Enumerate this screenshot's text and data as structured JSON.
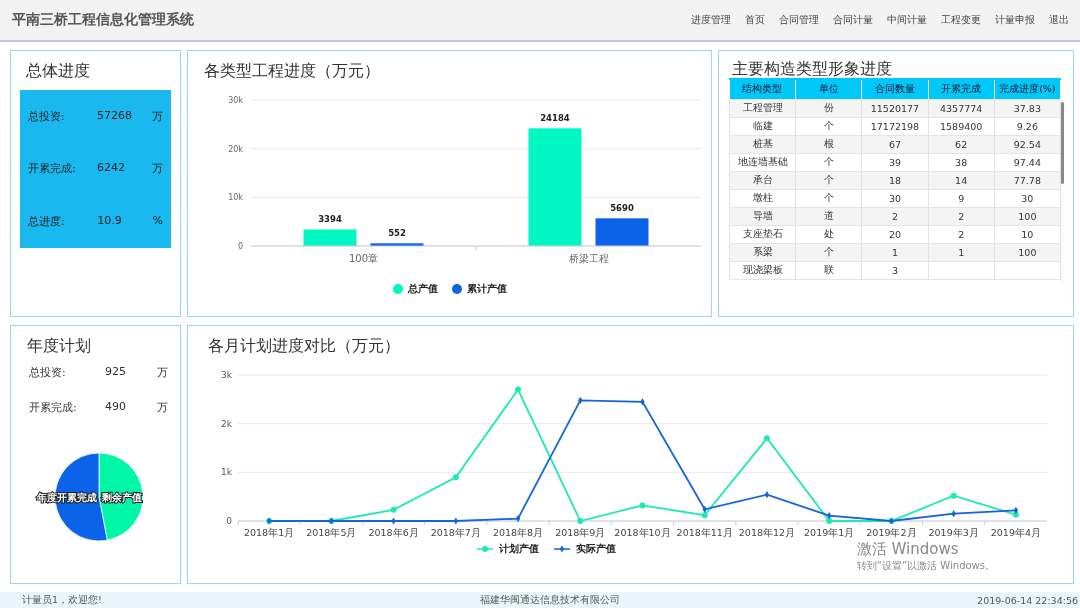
{
  "header": {
    "title": "平南三桥工程信息化管理系统",
    "nav": [
      {
        "label": "进度管理"
      },
      {
        "label": "首页"
      },
      {
        "label": "合同管理"
      },
      {
        "label": "合同计量"
      },
      {
        "label": "中间计量"
      },
      {
        "label": "工程变更"
      },
      {
        "label": "计量申报"
      },
      {
        "label": "退出"
      }
    ]
  },
  "overall": {
    "title": "总体进度",
    "rows": [
      {
        "label": "总投资:",
        "value": "57268",
        "unit": "万"
      },
      {
        "label": "开累完成:",
        "value": "6242",
        "unit": "万"
      },
      {
        "label": "总进度:",
        "value": "10.9",
        "unit": "%"
      }
    ]
  },
  "type_progress": {
    "title": "各类型工程进度（万元）",
    "chart_data": {
      "type": "bar",
      "categories": [
        "100章",
        "桥梁工程"
      ],
      "series": [
        {
          "name": "总产值",
          "color": "#00f7c3",
          "values": [
            3394,
            24184
          ]
        },
        {
          "name": "累计产值",
          "color": "#0a63e8",
          "values": [
            552,
            5690
          ]
        }
      ],
      "ylim": [
        0,
        30000
      ],
      "yticks": [
        {
          "value": 0,
          "label": "0"
        },
        {
          "value": 10000,
          "label": "10k"
        },
        {
          "value": 20000,
          "label": "20k"
        },
        {
          "value": 30000,
          "label": "30k"
        }
      ],
      "data_labels": true
    }
  },
  "structures": {
    "title": "主要构造类型形象进度",
    "columns": [
      "结构类型",
      "单位",
      "合同数量",
      "开累完成",
      "完成进度(%)"
    ],
    "rows": [
      [
        "工程管理",
        "份",
        "11520177",
        "4357774",
        "37.83"
      ],
      [
        "临建",
        "个",
        "17172198",
        "1589400",
        "9.26"
      ],
      [
        "桩基",
        "根",
        "67",
        "62",
        "92.54"
      ],
      [
        "地连墙基础",
        "个",
        "39",
        "38",
        "97.44"
      ],
      [
        "承台",
        "个",
        "18",
        "14",
        "77.78"
      ],
      [
        "墩柱",
        "个",
        "30",
        "9",
        "30"
      ],
      [
        "导墙",
        "道",
        "2",
        "2",
        "100"
      ],
      [
        "支座垫石",
        "处",
        "20",
        "2",
        "10"
      ],
      [
        "系梁",
        "个",
        "1",
        "1",
        "100"
      ],
      [
        "现浇梁板",
        "联",
        "3"
      ]
    ]
  },
  "annual": {
    "title": "年度计划",
    "rows": [
      {
        "label": "总投资:",
        "value": "925",
        "unit": "万"
      },
      {
        "label": "开累完成:",
        "value": "490",
        "unit": "万"
      }
    ],
    "chart_data": {
      "type": "pie",
      "categories": [
        "剩余产值",
        "年度开累完成"
      ],
      "values": [
        47,
        53
      ],
      "colors": [
        "#00f7a8",
        "#0a63e8"
      ]
    }
  },
  "monthly": {
    "title": "各月计划进度对比（万元）",
    "chart_data": {
      "type": "line",
      "categories": [
        "2018年1月",
        "2018年5月",
        "2018年6月",
        "2018年7月",
        "2018年8月",
        "2018年9月",
        "2018年10月",
        "2018年11月",
        "2018年12月",
        "2019年1月",
        "2019年2月",
        "2019年3月",
        "2019年4月"
      ],
      "series": [
        {
          "name": "计划产值",
          "color": "#1de9b6",
          "marker": "circle",
          "values": [
            0,
            0,
            230,
            900,
            2700,
            0,
            320,
            120,
            1700,
            0,
            0,
            520,
            130
          ]
        },
        {
          "name": "实际产值",
          "color": "#1565d8",
          "marker": "diamond",
          "values": [
            0,
            0,
            0,
            0,
            50,
            2480,
            2450,
            240,
            540,
            110,
            0,
            150,
            220
          ]
        }
      ],
      "ylim": [
        0,
        3000
      ],
      "yticks": [
        {
          "value": 0,
          "label": "0"
        },
        {
          "value": 1000,
          "label": "1k"
        },
        {
          "value": 2000,
          "label": "2k"
        },
        {
          "value": 3000,
          "label": "3k"
        }
      ]
    }
  },
  "os_notice": {
    "title": "激活 Windows",
    "hint": "转到“设置”以激活 Windows。"
  },
  "footer": {
    "user": "计量员1，欢迎您!",
    "company": "福建华闽通达信息技术有限公司",
    "time": "2019-06-14 22:34:56"
  }
}
